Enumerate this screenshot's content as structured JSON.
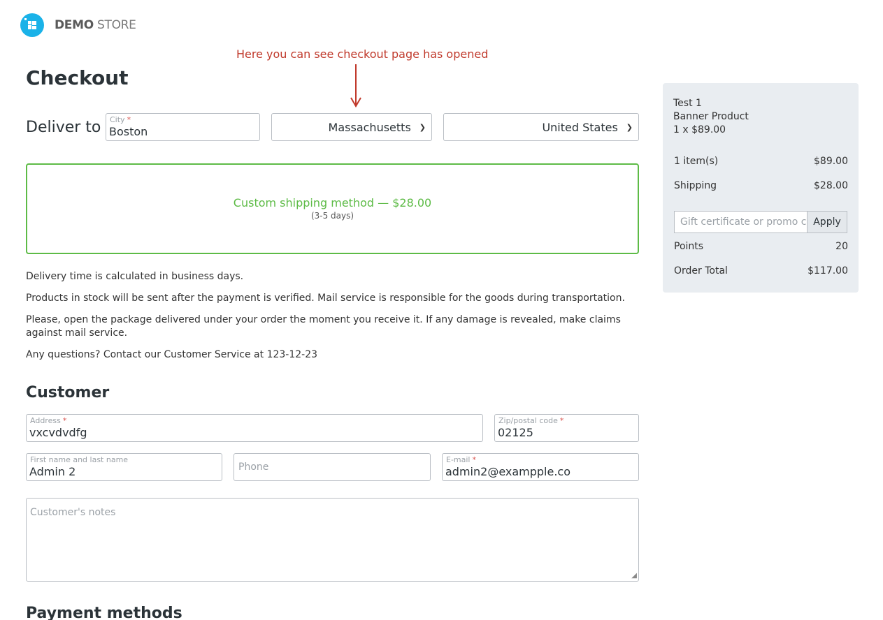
{
  "brand": {
    "name_bold": "DEMO",
    "name_light": "STORE"
  },
  "annotation": {
    "text": "Here you can see checkout page has opened"
  },
  "page": {
    "title": "Checkout"
  },
  "delivery": {
    "label": "Deliver to",
    "city": {
      "label": "City",
      "value": "Boston"
    },
    "state": {
      "value": "Massachusetts"
    },
    "country": {
      "value": "United States"
    }
  },
  "shipping": {
    "name": "Custom shipping method — $28.00",
    "days": "(3-5 days)"
  },
  "info": [
    "Delivery time is calculated in business days.",
    "Products in stock will be sent after the payment is verified. Mail service is responsible for the goods during transportation.",
    "Please, open the package delivered under your order the moment you receive it. If any damage is revealed, make claims against mail service.",
    "Any questions? Contact our Customer Service at 123-12-23"
  ],
  "customer": {
    "title": "Customer",
    "address": {
      "label": "Address",
      "value": "vxcvdvdfg"
    },
    "zip": {
      "label": "Zip/postal code",
      "value": "02125"
    },
    "name": {
      "label": "First name and last name",
      "value": "Admin 2"
    },
    "phone": {
      "placeholder": "Phone"
    },
    "email": {
      "label": "E-mail",
      "value": "admin2@exampple.co"
    },
    "notes": {
      "placeholder": "Customer's notes"
    }
  },
  "payment": {
    "title": "Payment methods"
  },
  "summary": {
    "item_title": "Test 1",
    "item_name": "Banner Product",
    "item_qty": "1 x $89.00",
    "items_label": "1 item(s)",
    "items_value": "$89.00",
    "shipping_label": "Shipping",
    "shipping_value": "$28.00",
    "promo_placeholder": "Gift certificate or promo code",
    "promo_button": "Apply",
    "points_label": "Points",
    "points_value": "20",
    "total_label": "Order Total",
    "total_value": "$117.00"
  },
  "colors": {
    "accent_green": "#5dbb46",
    "annotation_red": "#c0392b",
    "logo_blue": "#1ab2e8"
  }
}
